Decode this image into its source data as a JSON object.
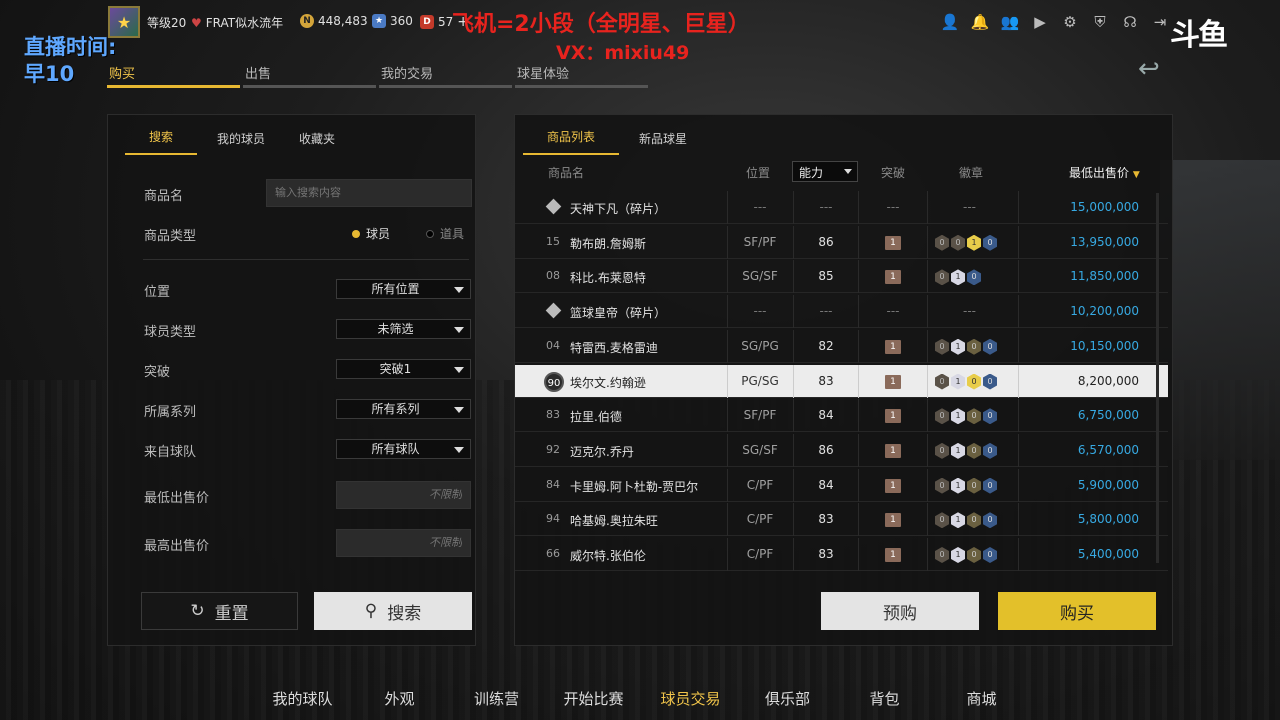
{
  "topbar": {
    "level": "等级20",
    "team_name": "FRAT似水流年",
    "coins": "448,483",
    "stars": "360",
    "tickets": "57"
  },
  "overlay": {
    "line1": "飞机=2小段（全明星、巨星）",
    "line2": "VX：mixiu49",
    "live_time_1": "直播时间:",
    "live_time_2": "早10"
  },
  "brand": "斗鱼",
  "main_tabs": [
    "购买",
    "出售",
    "我的交易",
    "球星体验"
  ],
  "left_panel": {
    "tabs": [
      "搜索",
      "我的球员",
      "收藏夹"
    ],
    "fields": {
      "name_label": "商品名",
      "name_placeholder": "输入搜索内容",
      "type_label": "商品类型",
      "type_option_player": "球员",
      "type_option_item": "道具",
      "position_label": "位置",
      "position_value": "所有位置",
      "player_type_label": "球员类型",
      "player_type_value": "未筛选",
      "breakthrough_label": "突破",
      "breakthrough_value": "突破1",
      "series_label": "所属系列",
      "series_value": "所有系列",
      "team_label": "来自球队",
      "team_value": "所有球队",
      "min_price_label": "最低出售价",
      "min_price_placeholder": "不限制",
      "max_price_label": "最高出售价",
      "max_price_placeholder": "不限制"
    },
    "reset_label": "重置",
    "search_label": "搜索"
  },
  "right_panel": {
    "tabs": [
      "商品列表",
      "新品球星"
    ],
    "headers": {
      "name": "商品名",
      "position": "位置",
      "ability": "能力",
      "breakthrough": "突破",
      "badges": "徽章",
      "price": "最低出售价"
    },
    "rows": [
      {
        "num": "",
        "name": "天神下凡（碎片）",
        "pos": "---",
        "abil": "---",
        "bt": "---",
        "badges": [],
        "price": "15,000,000",
        "fragment": true
      },
      {
        "num": "15",
        "name": "勒布朗.詹姆斯",
        "pos": "SF/PF",
        "abil": "86",
        "bt": "1",
        "badges": [
          [
            "0",
            "b0"
          ],
          [
            "0",
            "b0"
          ],
          [
            "1",
            "b2"
          ],
          [
            "0",
            "b3"
          ]
        ],
        "price": "13,950,000"
      },
      {
        "num": "08",
        "name": "科比.布莱恩特",
        "pos": "SG/SF",
        "abil": "85",
        "bt": "1",
        "badges": [
          [
            "0",
            "b0"
          ],
          [
            "1",
            "b1"
          ],
          [
            "0",
            "b3"
          ]
        ],
        "price": "11,850,000"
      },
      {
        "num": "",
        "name": "篮球皇帝（碎片）",
        "pos": "---",
        "abil": "---",
        "bt": "---",
        "badges": [],
        "price": "10,200,000",
        "fragment": true
      },
      {
        "num": "04",
        "name": "特雷西.麦格雷迪",
        "pos": "SG/PG",
        "abil": "82",
        "bt": "1",
        "badges": [
          [
            "0",
            "b0"
          ],
          [
            "1",
            "b1"
          ],
          [
            "0",
            "b4"
          ],
          [
            "0",
            "b3"
          ]
        ],
        "price": "10,150,000"
      },
      {
        "num": "90",
        "name": "埃尔文.约翰逊",
        "pos": "PG/SG",
        "abil": "83",
        "bt": "1",
        "badges": [
          [
            "0",
            "b0"
          ],
          [
            "1",
            "b1"
          ],
          [
            "0",
            "b2"
          ],
          [
            "0",
            "b3"
          ]
        ],
        "price": "8,200,000",
        "selected": true
      },
      {
        "num": "83",
        "name": "拉里.伯德",
        "pos": "SF/PF",
        "abil": "84",
        "bt": "1",
        "badges": [
          [
            "0",
            "b0"
          ],
          [
            "1",
            "b1"
          ],
          [
            "0",
            "b4"
          ],
          [
            "0",
            "b3"
          ]
        ],
        "price": "6,750,000"
      },
      {
        "num": "92",
        "name": "迈克尔.乔丹",
        "pos": "SG/SF",
        "abil": "86",
        "bt": "1",
        "badges": [
          [
            "0",
            "b0"
          ],
          [
            "1",
            "b1"
          ],
          [
            "0",
            "b4"
          ],
          [
            "0",
            "b3"
          ]
        ],
        "price": "6,570,000"
      },
      {
        "num": "84",
        "name": "卡里姆.阿卜杜勒-贾巴尔",
        "pos": "C/PF",
        "abil": "84",
        "bt": "1",
        "badges": [
          [
            "0",
            "b0"
          ],
          [
            "1",
            "b1"
          ],
          [
            "0",
            "b4"
          ],
          [
            "0",
            "b3"
          ]
        ],
        "price": "5,900,000"
      },
      {
        "num": "94",
        "name": "哈基姆.奥拉朱旺",
        "pos": "C/PF",
        "abil": "83",
        "bt": "1",
        "badges": [
          [
            "0",
            "b0"
          ],
          [
            "1",
            "b1"
          ],
          [
            "0",
            "b4"
          ],
          [
            "0",
            "b3"
          ]
        ],
        "price": "5,800,000"
      },
      {
        "num": "66",
        "name": "威尔特.张伯伦",
        "pos": "C/PF",
        "abil": "83",
        "bt": "1",
        "badges": [
          [
            "0",
            "b0"
          ],
          [
            "1",
            "b1"
          ],
          [
            "0",
            "b4"
          ],
          [
            "0",
            "b3"
          ]
        ],
        "price": "5,400,000"
      }
    ],
    "preorder_label": "预购",
    "buy_label": "购买"
  },
  "bottom_nav": [
    "我的球队",
    "外观",
    "训练营",
    "开始比赛",
    "球员交易",
    "俱乐部",
    "背包",
    "商城"
  ],
  "bottom_nav_active": 4
}
